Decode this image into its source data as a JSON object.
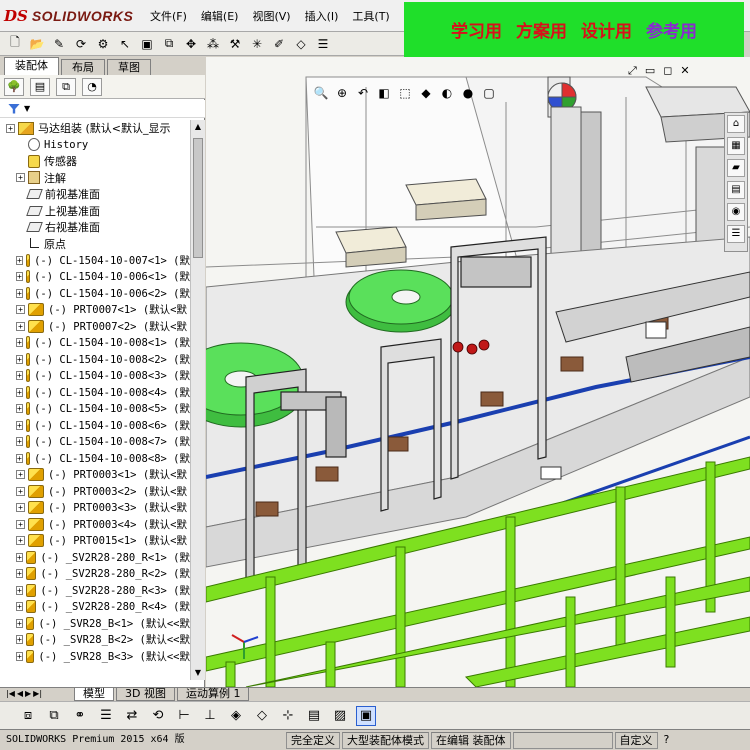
{
  "app": {
    "logo_mark": "DS",
    "logo_text": "SOLIDWORKS"
  },
  "menu": [
    "文件(F)",
    "编辑(E)",
    "视图(V)",
    "插入(I)",
    "工具(T)"
  ],
  "banner": [
    "学习用",
    "方案用",
    "设计用",
    "参考用"
  ],
  "fm_tabs": [
    "装配体",
    "布局",
    "草图"
  ],
  "tree": [
    {
      "label": "马达组装  (默认<默认_显示",
      "icon": "asm",
      "exp": "+",
      "indent": 0
    },
    {
      "label": "History",
      "icon": "hist",
      "exp": "",
      "indent": 1
    },
    {
      "label": "传感器",
      "icon": "sensor",
      "exp": "",
      "indent": 1
    },
    {
      "label": "注解",
      "icon": "note",
      "exp": "+",
      "indent": 1
    },
    {
      "label": "前视基准面",
      "icon": "plane",
      "exp": "",
      "indent": 1
    },
    {
      "label": "上视基准面",
      "icon": "plane",
      "exp": "",
      "indent": 1
    },
    {
      "label": "右视基准面",
      "icon": "plane",
      "exp": "",
      "indent": 1
    },
    {
      "label": "原点",
      "icon": "origin",
      "exp": "",
      "indent": 1
    },
    {
      "label": "(-) CL-1504-10-007<1>  (默",
      "icon": "part",
      "exp": "+",
      "indent": 1
    },
    {
      "label": "(-) CL-1504-10-006<1>  (默",
      "icon": "part",
      "exp": "+",
      "indent": 1
    },
    {
      "label": "(-) CL-1504-10-006<2>  (默",
      "icon": "part",
      "exp": "+",
      "indent": 1
    },
    {
      "label": "(-) PRT0007<1>  (默认<默",
      "icon": "part",
      "exp": "+",
      "indent": 1
    },
    {
      "label": "(-) PRT0007<2>  (默认<默",
      "icon": "part",
      "exp": "+",
      "indent": 1
    },
    {
      "label": "(-) CL-1504-10-008<1>  (默",
      "icon": "part",
      "exp": "+",
      "indent": 1
    },
    {
      "label": "(-) CL-1504-10-008<2>  (默",
      "icon": "part",
      "exp": "+",
      "indent": 1
    },
    {
      "label": "(-) CL-1504-10-008<3>  (默",
      "icon": "part",
      "exp": "+",
      "indent": 1
    },
    {
      "label": "(-) CL-1504-10-008<4>  (默",
      "icon": "part",
      "exp": "+",
      "indent": 1
    },
    {
      "label": "(-) CL-1504-10-008<5>  (默",
      "icon": "part",
      "exp": "+",
      "indent": 1
    },
    {
      "label": "(-) CL-1504-10-008<6>  (默",
      "icon": "part",
      "exp": "+",
      "indent": 1
    },
    {
      "label": "(-) CL-1504-10-008<7>  (默",
      "icon": "part",
      "exp": "+",
      "indent": 1
    },
    {
      "label": "(-) CL-1504-10-008<8>  (默",
      "icon": "part",
      "exp": "+",
      "indent": 1
    },
    {
      "label": "(-) PRT0003<1>  (默认<默",
      "icon": "part",
      "exp": "+",
      "indent": 1
    },
    {
      "label": "(-) PRT0003<2>  (默认<默",
      "icon": "part",
      "exp": "+",
      "indent": 1
    },
    {
      "label": "(-) PRT0003<3>  (默认<默",
      "icon": "part",
      "exp": "+",
      "indent": 1
    },
    {
      "label": "(-) PRT0003<4>  (默认<默",
      "icon": "part",
      "exp": "+",
      "indent": 1
    },
    {
      "label": "(-) PRT0015<1>  (默认<默",
      "icon": "part",
      "exp": "+",
      "indent": 1
    },
    {
      "label": "(-) _SV2R28-280_R<1>  (默",
      "icon": "part",
      "exp": "+",
      "indent": 1
    },
    {
      "label": "(-) _SV2R28-280_R<2>  (默",
      "icon": "part",
      "exp": "+",
      "indent": 1
    },
    {
      "label": "(-) _SV2R28-280_R<3>  (默",
      "icon": "part",
      "exp": "+",
      "indent": 1
    },
    {
      "label": "(-) _SV2R28-280_R<4>  (默",
      "icon": "part",
      "exp": "+",
      "indent": 1
    },
    {
      "label": "(-) _SVR28_B<1>  (默认<<默",
      "icon": "part",
      "exp": "+",
      "indent": 1
    },
    {
      "label": "(-) _SVR28_B<2>  (默认<<默",
      "icon": "part",
      "exp": "+",
      "indent": 1
    },
    {
      "label": "(-) _SVR28_B<3>  (默认<<默",
      "icon": "part",
      "exp": "+",
      "indent": 1
    }
  ],
  "bottom_tabs": [
    "模型",
    "3D 视图",
    "运动算例 1"
  ],
  "status": {
    "app": "SOLIDWORKS Premium 2015 x64 版",
    "defined": "完全定义",
    "mode": "大型装配体模式",
    "editing": "在编辑 装配体",
    "custom": "自定义"
  },
  "colors": {
    "banner_bg": "#1fdf2a",
    "banner_text": "#d8101a",
    "banner_last": "#8a2ad0",
    "frame_green": "#7ee020",
    "bowl_green": "#49d64a"
  },
  "icons": {
    "toolbar": [
      "new-doc",
      "open",
      "pen",
      "rebuild",
      "options",
      "select",
      "component",
      "mate",
      "move",
      "pattern",
      "smart-fastener",
      "exploded",
      "sketch",
      "reference",
      "bom"
    ],
    "view": [
      "zoom-fit",
      "zoom-area",
      "prev-view",
      "section",
      "view-orient",
      "display-style",
      "hide-show",
      "appearance",
      "scene"
    ]
  }
}
